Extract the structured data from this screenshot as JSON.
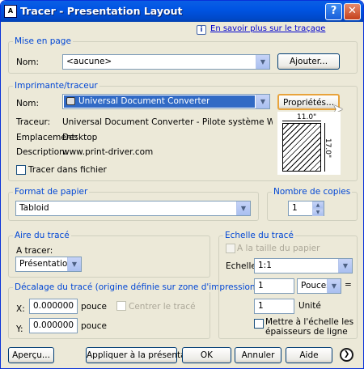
{
  "window": {
    "title": "Tracer - Presentation Layout",
    "app_icon": "A",
    "help_btn": "?",
    "close_btn": "✕"
  },
  "info_link": "En savoir plus sur le traçage",
  "page_setup": {
    "group": "Mise en page",
    "name_label": "Nom:",
    "name_value": "<aucune>",
    "add_button": "Ajouter..."
  },
  "printer": {
    "group": "Imprimante/traceur",
    "name_label": "Nom:",
    "name_value": "Universal Document Converter",
    "properties_button": "Propriétés...",
    "plotter_label": "Traceur:",
    "plotter_value": "Universal Document Converter - Pilote système Windows - par A...",
    "location_label": "Emplacement:",
    "location_value": "Desktop",
    "description_label": "Description:",
    "description_value": "www.print-driver.com",
    "plot_to_file_label": "Tracer dans fichier",
    "preview_width": "11.0\"",
    "preview_height": "17.0\""
  },
  "paper": {
    "group": "Format de papier",
    "value": "Tabloid"
  },
  "copies": {
    "group": "Nombre de copies",
    "value": "1"
  },
  "plot_area": {
    "group": "Aire du tracé",
    "what_label": "A tracer:",
    "what_value": "Présentation"
  },
  "plot_offset": {
    "group": "Décalage du tracé (origine définie sur zone d'impression)",
    "x_label": "X:",
    "x_value": "0.000000",
    "x_unit": "pouce",
    "y_label": "Y:",
    "y_value": "0.000000",
    "y_unit": "pouce",
    "center_label": "Centrer le tracé"
  },
  "scale": {
    "group": "Echelle du tracé",
    "fit_label": "A la taille du papier",
    "scale_label": "Echelle:",
    "scale_value": "1:1",
    "num_value": "1",
    "unit_value": "Pouces",
    "equals": "=",
    "den_value": "1",
    "den_unit": "Unité",
    "lineweights_label_1": "Mettre à l'échelle les",
    "lineweights_label_2": "épaisseurs de ligne"
  },
  "footer": {
    "preview": "Aperçu...",
    "apply": "Appliquer à la présentation",
    "ok": "OK",
    "cancel": "Annuler",
    "help": "Aide",
    "more": "❯"
  }
}
